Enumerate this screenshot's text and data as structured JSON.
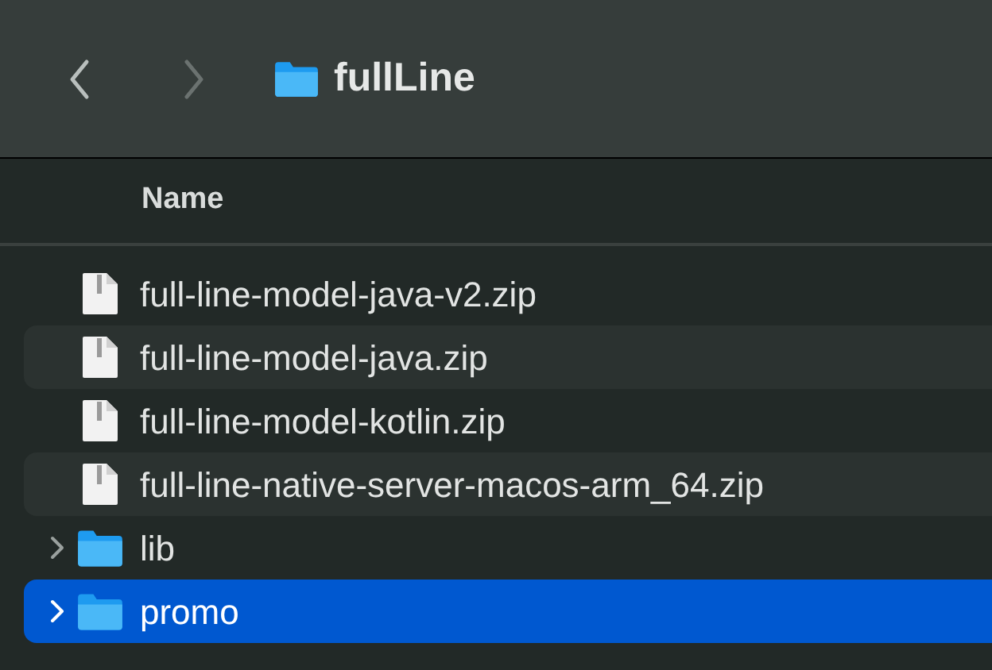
{
  "toolbar": {
    "back": {
      "disabled": false
    },
    "forward": {
      "disabled": true
    },
    "title": "fullLine"
  },
  "table": {
    "columns": [
      "Name"
    ],
    "rows": [
      {
        "kind": "file",
        "name": "full-line-model-java-v2.zip",
        "selected": false
      },
      {
        "kind": "file",
        "name": "full-line-model-java.zip",
        "selected": false
      },
      {
        "kind": "file",
        "name": "full-line-model-kotlin.zip",
        "selected": false
      },
      {
        "kind": "file",
        "name": "full-line-native-server-macos-arm_64.zip",
        "selected": false
      },
      {
        "kind": "folder",
        "name": "lib",
        "selected": false,
        "expanded": false
      },
      {
        "kind": "folder",
        "name": "promo",
        "selected": true,
        "expanded": false
      }
    ]
  }
}
